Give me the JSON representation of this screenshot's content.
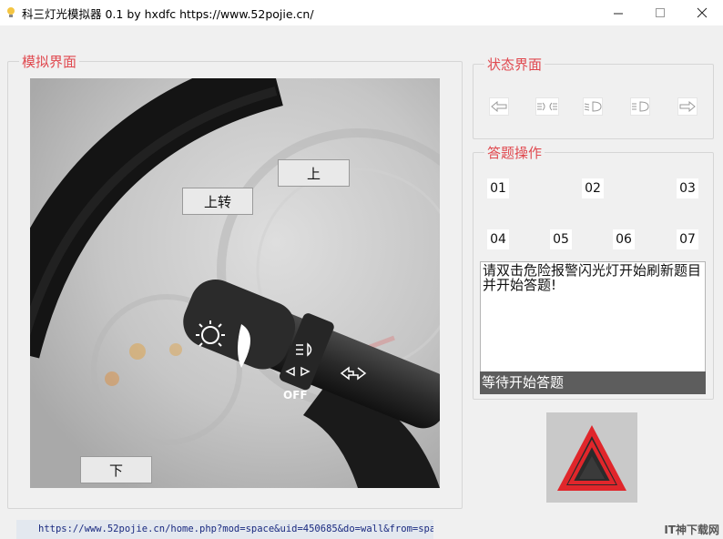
{
  "window": {
    "title": "科三灯光模拟器 0.1 by hxdfc https://www.52pojie.cn/",
    "minimize_glyph": "—",
    "maximize_glyph": "☐",
    "close_glyph": "✕"
  },
  "simulation": {
    "group_title": "模拟界面",
    "up_label": "上",
    "turn_up_label": "上转",
    "down_label": "下",
    "stalk_off_label": "OFF"
  },
  "status_panel": {
    "group_title": "状态界面",
    "icons": [
      "left-turn-arrow-icon",
      "position-lights-icon",
      "low-beam-icon",
      "high-beam-icon",
      "right-turn-arrow-icon"
    ]
  },
  "answer_panel": {
    "group_title": "答题操作",
    "buttons": [
      "01",
      "02",
      "03",
      "04",
      "05",
      "06",
      "07"
    ],
    "question_text": "请双击危险报警闪光灯开始刷新题目并开始答题!",
    "status_text": "等待开始答题"
  },
  "hazard": {
    "icon": "hazard-warning-triangle-icon",
    "color": "#e0262b"
  },
  "footer": {
    "url_text": "https://www.52pojie.cn/home.php?mod=space&uid=450685&do=wall&from=space",
    "watermark_text": "IT神下载网"
  },
  "colors": {
    "group_title": "#e0494f",
    "status_bar_bg": "#5d5d5d"
  }
}
